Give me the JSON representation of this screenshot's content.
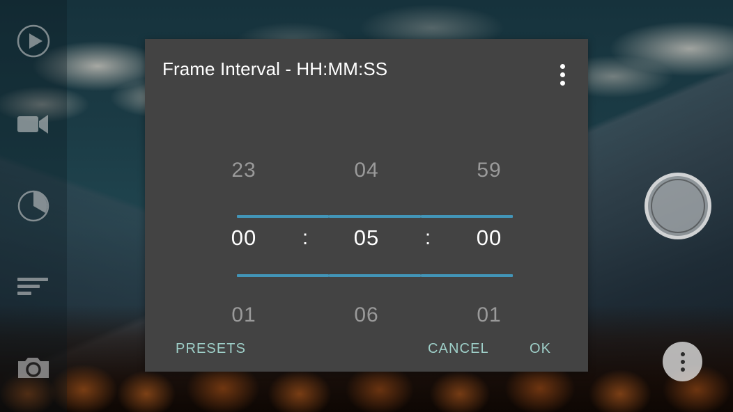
{
  "app": {
    "background_description": "camera-viewfinder-landscape"
  },
  "sidebar": {
    "items": [
      {
        "name": "play-icon",
        "label": "Play"
      },
      {
        "name": "video-icon",
        "label": "Video"
      },
      {
        "name": "timer-icon",
        "label": "Timer"
      },
      {
        "name": "lines-icon",
        "label": "Settings List"
      },
      {
        "name": "camera-icon",
        "label": "Camera"
      }
    ]
  },
  "viewfinder": {
    "shutter_label": "Shutter",
    "fab_label": "More options"
  },
  "dialog": {
    "title": "Frame Interval - HH:MM:SS",
    "overflow_menu_label": "More",
    "picker": {
      "above": [
        "23",
        "04",
        "59"
      ],
      "selected": [
        "00",
        "05",
        "00"
      ],
      "below": [
        "01",
        "06",
        "01"
      ],
      "separator": ":",
      "units": [
        "hours",
        "minutes",
        "seconds"
      ]
    },
    "buttons": {
      "presets": "PRESETS",
      "cancel": "CANCEL",
      "ok": "OK"
    }
  },
  "colors": {
    "dialog_background": "#434343",
    "rule": "#4295b8",
    "action_text": "#9ecfc8",
    "primary_text": "#ffffff",
    "dim_text": "#9a9a9a"
  }
}
